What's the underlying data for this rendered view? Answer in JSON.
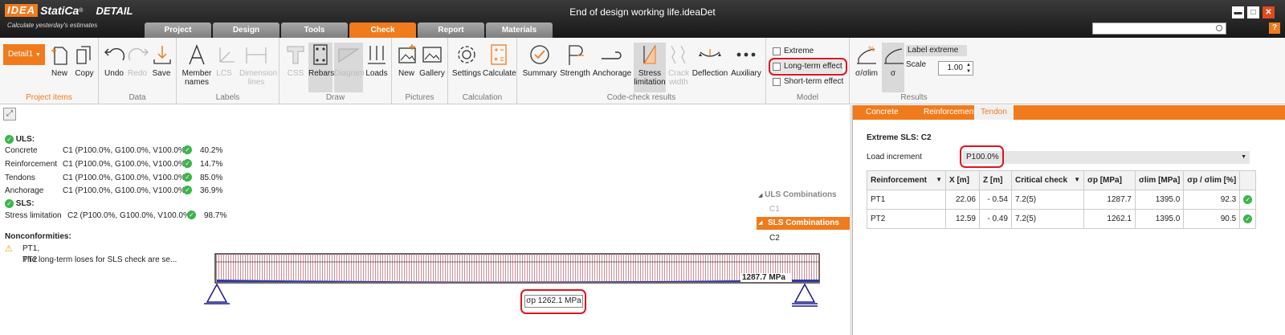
{
  "app": {
    "logo_brand": "IDEA",
    "logo_name": "StatiCa",
    "logo_mark": "®",
    "product": "DETAIL",
    "tagline": "Calculate yesterday's estimates",
    "doc_title": "End of design working life.ideaDet",
    "search_placeholder": "",
    "help": "?"
  },
  "tabs": [
    "Project",
    "Design",
    "Tools",
    "Check",
    "Report",
    "Materials"
  ],
  "window": {
    "min": "▬",
    "max": "□",
    "close": "✕"
  },
  "ribbon": {
    "project_items": {
      "dropdown": "Detail1",
      "new": "New",
      "copy": "Copy",
      "label": "Project items"
    },
    "data": {
      "undo": "Undo",
      "redo": "Redo",
      "save": "Save",
      "label": "Data"
    },
    "labels": {
      "member_names": "Member names",
      "lcs": "LCS",
      "dimension_lines": "Dimension lines",
      "label": "Labels"
    },
    "draw": {
      "css": "CSS",
      "rebars": "Rebars",
      "diagram": "Diagram",
      "loads": "Loads",
      "label": "Draw"
    },
    "pictures": {
      "new": "New",
      "gallery": "Gallery",
      "label": "Pictures"
    },
    "calculation": {
      "settings": "Settings",
      "calculate": "Calculate",
      "label": "Calculation"
    },
    "code_check": {
      "summary": "Summary",
      "strength": "Strength",
      "anchorage": "Anchorage",
      "stress_limitation": "Stress limitation",
      "crack_width": "Crack width",
      "deflection": "Deflection",
      "auxiliary": "Auxiliary",
      "label": "Code-check results"
    },
    "model": {
      "extreme": "Extreme",
      "long_term": "Long-term effect",
      "short_term": "Short-term effect",
      "label": "Model"
    },
    "results": {
      "sigma_lim": "σ/σlim",
      "sigma": "σ",
      "label_extreme": "Label extreme",
      "scale_label": "Scale",
      "scale_value": "1.00",
      "label": "Results"
    }
  },
  "summary": {
    "uls_title": "ULS:",
    "uls": [
      {
        "name": "Concrete",
        "combo": "C1 (P100.0%, G100.0%, V100.0%)",
        "value": "40.2%"
      },
      {
        "name": "Reinforcement",
        "combo": "C1 (P100.0%, G100.0%, V100.0%)",
        "value": "14.7%"
      },
      {
        "name": "Tendons",
        "combo": "C1 (P100.0%, G100.0%, V100.0%)",
        "value": "85.0%"
      },
      {
        "name": "Anchorage",
        "combo": "C1 (P100.0%, G100.0%, V100.0%)",
        "value": "36.9%"
      }
    ],
    "sls_title": "SLS:",
    "sls": [
      {
        "name": "Stress limitation",
        "combo": "C2 (P100.0%, G100.0%, V100.0%)",
        "value": "98.7%"
      }
    ],
    "nonconf_title": "Nonconformities:",
    "nonconf_items": "PT1, PT2",
    "nonconf_text": "The long-term loses for SLS check are se..."
  },
  "combinations": {
    "uls_header": "ULS Combinations",
    "uls_items": [
      "C1"
    ],
    "sls_header": "SLS Combinations",
    "sls_items": [
      "C2"
    ]
  },
  "beam": {
    "max_label": "1287.7 MPa",
    "sigma_label": "σp 1262.1 MPa"
  },
  "right": {
    "tabs": [
      "Concrete",
      "Reinforcement",
      "Tendon"
    ],
    "title": "Extreme SLS: C2",
    "load_increment_label": "Load increment",
    "load_increment_value": "P100.0%",
    "table": {
      "headers": [
        "Reinforcement",
        "X [m]",
        "Z [m]",
        "Critical check",
        "σp [MPa]",
        "σlim [MPa]",
        "σp / σlim [%]",
        ""
      ],
      "rows": [
        [
          "PT1",
          "22.06",
          "- 0.54",
          "7.2(5)",
          "1287.7",
          "1395.0",
          "92.3"
        ],
        [
          "PT2",
          "12.59",
          "- 0.49",
          "7.2(5)",
          "1262.1",
          "1395.0",
          "90.5"
        ]
      ]
    }
  },
  "colors": {
    "accent": "#f07b1c",
    "ok": "#3cb54a",
    "highlight": "#e0141e",
    "beam": "#1a1a8c"
  }
}
